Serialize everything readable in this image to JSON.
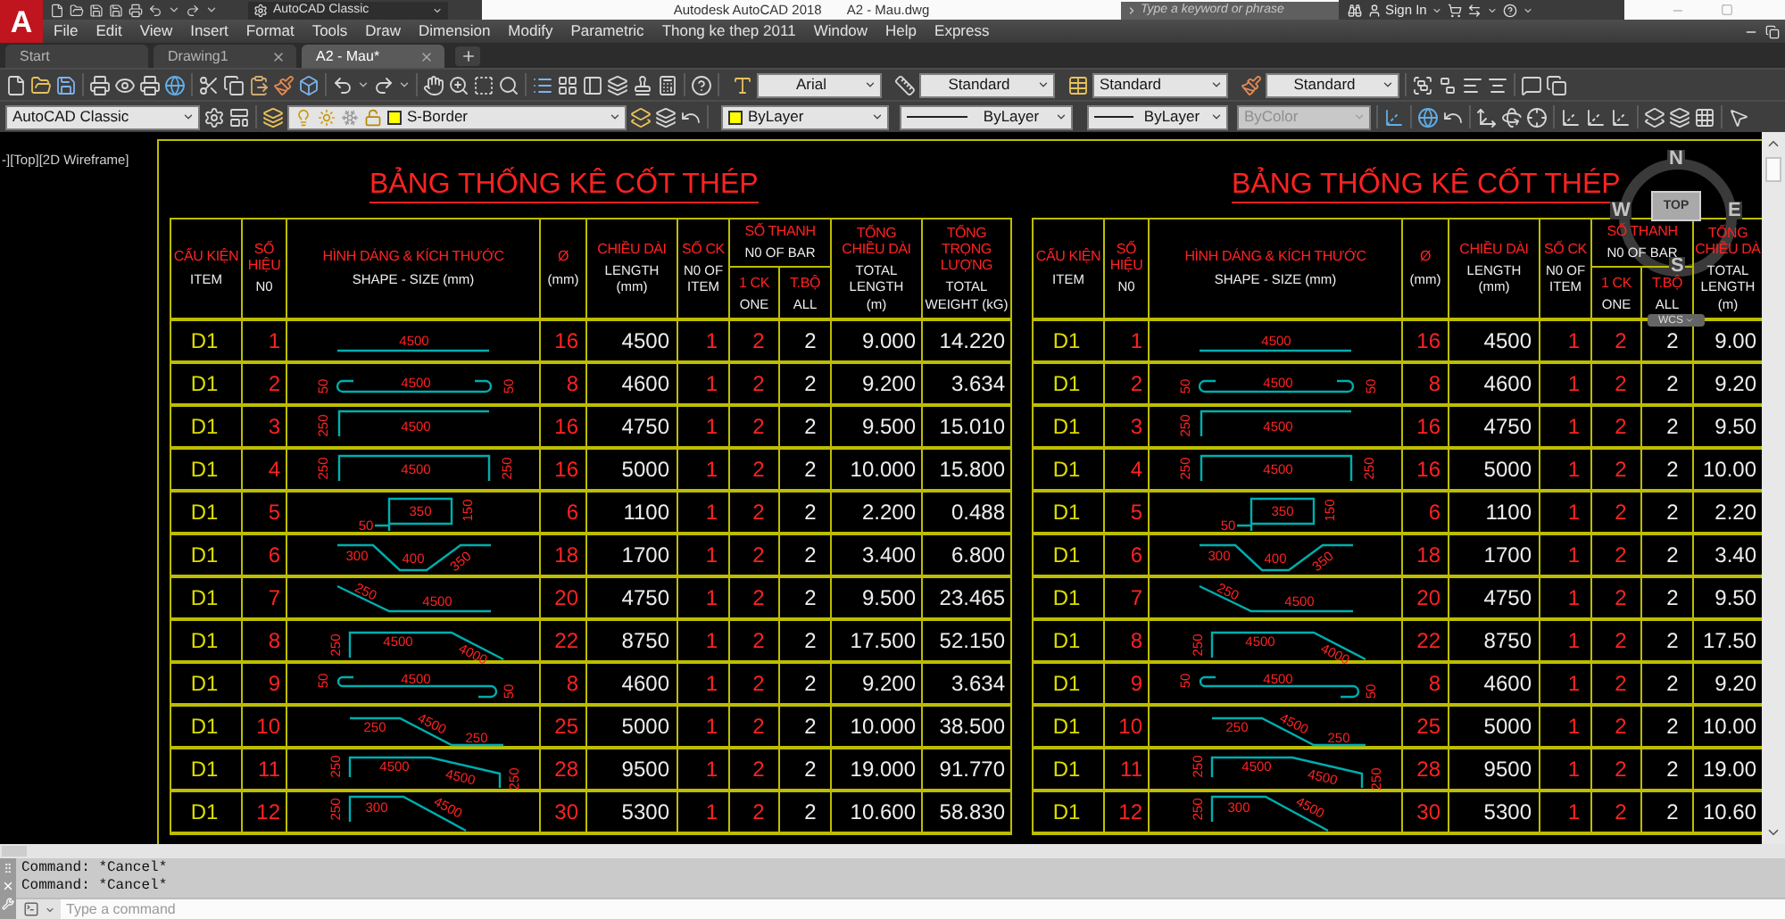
{
  "app_logo": "A",
  "title_bar": {
    "workspace": "AutoCAD Classic",
    "app": "Autodesk AutoCAD 2018",
    "file": "A2 - Mau.dwg",
    "search": {
      "placeholder": "Type a keyword or phrase"
    },
    "sign_in": "Sign In"
  },
  "menu": [
    "File",
    "Edit",
    "View",
    "Insert",
    "Format",
    "Tools",
    "Draw",
    "Dimension",
    "Modify",
    "Parametric",
    "Thong ke thep 2011",
    "Window",
    "Help",
    "Express"
  ],
  "tabs": [
    {
      "label": "Start",
      "selected": false,
      "closable": false
    },
    {
      "label": "Drawing1",
      "selected": false,
      "closable": true
    },
    {
      "label": "A2 - Mau*",
      "selected": true,
      "closable": true
    }
  ],
  "styles_toolbar": {
    "text_style": "Arial",
    "dimension_style": "Standard",
    "table_style": "Standard",
    "multileader_style": "Standard"
  },
  "properties_toolbar": {
    "workspace": "AutoCAD Classic",
    "layer": "S-Border",
    "color_control": "ByLayer",
    "linetype": "ByLayer",
    "lineweight": "ByLayer",
    "plot_style": {
      "label": "ByColor",
      "disabled": true
    }
  },
  "viewport_label": "-][Top][2D Wireframe]",
  "tables": [
    {
      "title": "BẢNG THỐNG KÊ CỐT THÉP",
      "columns": [
        {
          "vi": [
            "CẤU KIỆN"
          ],
          "en": [
            "ITEM"
          ]
        },
        {
          "vi": [
            "SỐ",
            "HIỆU"
          ],
          "en": [
            "N0"
          ]
        },
        {
          "vi": [
            "HÌNH DÁNG & KÍCH THƯỚC"
          ],
          "en": [
            "SHAPE - SIZE (mm)"
          ]
        },
        {
          "vi": [
            "Ø"
          ],
          "en": [
            "(mm)"
          ]
        },
        {
          "vi": [
            "CHIỀU DÀI"
          ],
          "en": [
            "LENGTH",
            "(mm)"
          ]
        },
        {
          "vi": [
            "SỐ CK"
          ],
          "en": [
            "N0 OF",
            "ITEM"
          ]
        },
        {
          "vi": [
            "SỐ THANH"
          ],
          "en": [
            "N0 OF BAR"
          ],
          "sub": [
            {
              "vi": [
                "1 CK"
              ],
              "en": [
                "ONE"
              ]
            },
            {
              "vi": [
                "T.BỘ"
              ],
              "en": [
                "ALL"
              ]
            }
          ]
        },
        {
          "vi": [
            "TỔNG",
            "CHIỀU DÀI"
          ],
          "en": [
            "TOTAL",
            "LENGTH",
            "(m)"
          ]
        },
        {
          "vi": [
            "TỔNG",
            "TRỌNG",
            "LƯỢNG"
          ],
          "en": [
            "TOTAL",
            "WEIGHT (kG)"
          ]
        }
      ],
      "rows": [
        {
          "item": "D1",
          "no": "1",
          "shape": {
            "kind": "straight",
            "labels": [
              "4500"
            ]
          },
          "diameter": "16",
          "length": "4500",
          "count_item": "1",
          "bars_one": "2",
          "bars_all": "2",
          "total_length": "9.000",
          "total_weight": "14.220"
        },
        {
          "item": "D1",
          "no": "2",
          "shape": {
            "kind": "double-hook",
            "labels": [
              "50",
              "4500",
              "50"
            ]
          },
          "diameter": "8",
          "length": "4600",
          "count_item": "1",
          "bars_one": "2",
          "bars_all": "2",
          "total_length": "9.200",
          "total_weight": "3.634"
        },
        {
          "item": "D1",
          "no": "3",
          "shape": {
            "kind": "l-bar",
            "labels": [
              "250",
              "4500"
            ]
          },
          "diameter": "16",
          "length": "4750",
          "count_item": "1",
          "bars_one": "2",
          "bars_all": "2",
          "total_length": "9.500",
          "total_weight": "15.010"
        },
        {
          "item": "D1",
          "no": "4",
          "shape": {
            "kind": "u-bar",
            "labels": [
              "250",
              "4500",
              "250"
            ]
          },
          "diameter": "16",
          "length": "5000",
          "count_item": "1",
          "bars_one": "2",
          "bars_all": "2",
          "total_length": "10.000",
          "total_weight": "15.800"
        },
        {
          "item": "D1",
          "no": "5",
          "shape": {
            "kind": "stirrup",
            "labels": [
              "50",
              "350",
              "150"
            ]
          },
          "diameter": "6",
          "length": "1100",
          "count_item": "1",
          "bars_one": "2",
          "bars_all": "2",
          "total_length": "2.200",
          "total_weight": "0.488"
        },
        {
          "item": "D1",
          "no": "6",
          "shape": {
            "kind": "trapezoid",
            "labels": [
              "300",
              "400",
              "350"
            ]
          },
          "diameter": "18",
          "length": "1700",
          "count_item": "1",
          "bars_one": "2",
          "bars_all": "2",
          "total_length": "3.400",
          "total_weight": "6.800"
        },
        {
          "item": "D1",
          "no": "7",
          "shape": {
            "kind": "bent-start",
            "labels": [
              "250",
              "4500"
            ]
          },
          "diameter": "20",
          "length": "4750",
          "count_item": "1",
          "bars_one": "2",
          "bars_all": "2",
          "total_length": "9.500",
          "total_weight": "23.465"
        },
        {
          "item": "D1",
          "no": "8",
          "shape": {
            "kind": "l-bent",
            "labels": [
              "250",
              "4500",
              "4000"
            ]
          },
          "diameter": "22",
          "length": "8750",
          "count_item": "1",
          "bars_one": "2",
          "bars_all": "2",
          "total_length": "17.500",
          "total_weight": "52.150"
        },
        {
          "item": "D1",
          "no": "9",
          "shape": {
            "kind": "offset-hook",
            "labels": [
              "50",
              "4500",
              "50"
            ]
          },
          "diameter": "8",
          "length": "4600",
          "count_item": "1",
          "bars_one": "2",
          "bars_all": "2",
          "total_length": "9.200",
          "total_weight": "3.634"
        },
        {
          "item": "D1",
          "no": "10",
          "shape": {
            "kind": "cranked",
            "labels": [
              "250",
              "4500",
              "250"
            ]
          },
          "diameter": "25",
          "length": "5000",
          "count_item": "1",
          "bars_one": "2",
          "bars_all": "2",
          "total_length": "10.000",
          "total_weight": "38.500"
        },
        {
          "item": "D1",
          "no": "11",
          "shape": {
            "kind": "l-slope-hook",
            "labels": [
              "250",
              "4500",
              "4500",
              "250"
            ]
          },
          "diameter": "28",
          "length": "9500",
          "count_item": "1",
          "bars_one": "2",
          "bars_all": "2",
          "total_length": "19.000",
          "total_weight": "91.770"
        },
        {
          "item": "D1",
          "no": "12",
          "shape": {
            "kind": "l-slope",
            "labels": [
              "250",
              "300",
              "4500"
            ]
          },
          "diameter": "30",
          "length": "5300",
          "count_item": "1",
          "bars_one": "2",
          "bars_all": "2",
          "total_length": "10.600",
          "total_weight": "58.830"
        }
      ]
    },
    {
      "title": "BẢNG THỐNG KÊ CỐT THÉP",
      "columns": [
        {
          "vi": [
            "CẤU KIỆN"
          ],
          "en": [
            "ITEM"
          ]
        },
        {
          "vi": [
            "SỐ",
            "HIỆU"
          ],
          "en": [
            "N0"
          ]
        },
        {
          "vi": [
            "HÌNH DÁNG & KÍCH THƯỚC"
          ],
          "en": [
            "SHAPE - SIZE (mm)"
          ]
        },
        {
          "vi": [
            "Ø"
          ],
          "en": [
            "(mm)"
          ]
        },
        {
          "vi": [
            "CHIỀU DÀI"
          ],
          "en": [
            "LENGTH",
            "(mm)"
          ]
        },
        {
          "vi": [
            "SỐ CK"
          ],
          "en": [
            "N0 OF",
            "ITEM"
          ]
        },
        {
          "vi": [
            "SỐ THANH"
          ],
          "en": [
            "N0 OF BAR"
          ],
          "sub": [
            {
              "vi": [
                "1 CK"
              ],
              "en": [
                "ONE"
              ]
            },
            {
              "vi": [
                "T.BỘ"
              ],
              "en": [
                "ALL"
              ]
            }
          ]
        },
        {
          "vi": [
            "TỔNG",
            "CHIỀU DÀ"
          ],
          "en": [
            "TOTAL",
            "LENGTH",
            "(m)"
          ]
        }
      ],
      "rows": [
        {
          "item": "D1",
          "no": "1",
          "shape": {
            "kind": "straight",
            "labels": [
              "4500"
            ]
          },
          "diameter": "16",
          "length": "4500",
          "count_item": "1",
          "bars_one": "2",
          "bars_all": "2",
          "total_length": "9.00"
        },
        {
          "item": "D1",
          "no": "2",
          "shape": {
            "kind": "double-hook",
            "labels": [
              "50",
              "4500",
              "50"
            ]
          },
          "diameter": "8",
          "length": "4600",
          "count_item": "1",
          "bars_one": "2",
          "bars_all": "2",
          "total_length": "9.20"
        },
        {
          "item": "D1",
          "no": "3",
          "shape": {
            "kind": "l-bar",
            "labels": [
              "250",
              "4500"
            ]
          },
          "diameter": "16",
          "length": "4750",
          "count_item": "1",
          "bars_one": "2",
          "bars_all": "2",
          "total_length": "9.50"
        },
        {
          "item": "D1",
          "no": "4",
          "shape": {
            "kind": "u-bar",
            "labels": [
              "250",
              "4500",
              "250"
            ]
          },
          "diameter": "16",
          "length": "5000",
          "count_item": "1",
          "bars_one": "2",
          "bars_all": "2",
          "total_length": "10.00"
        },
        {
          "item": "D1",
          "no": "5",
          "shape": {
            "kind": "stirrup",
            "labels": [
              "50",
              "350",
              "150"
            ]
          },
          "diameter": "6",
          "length": "1100",
          "count_item": "1",
          "bars_one": "2",
          "bars_all": "2",
          "total_length": "2.20"
        },
        {
          "item": "D1",
          "no": "6",
          "shape": {
            "kind": "trapezoid",
            "labels": [
              "300",
              "400",
              "350"
            ]
          },
          "diameter": "18",
          "length": "1700",
          "count_item": "1",
          "bars_one": "2",
          "bars_all": "2",
          "total_length": "3.40"
        },
        {
          "item": "D1",
          "no": "7",
          "shape": {
            "kind": "bent-start",
            "labels": [
              "250",
              "4500"
            ]
          },
          "diameter": "20",
          "length": "4750",
          "count_item": "1",
          "bars_one": "2",
          "bars_all": "2",
          "total_length": "9.50"
        },
        {
          "item": "D1",
          "no": "8",
          "shape": {
            "kind": "l-bent",
            "labels": [
              "250",
              "4500",
              "4000"
            ]
          },
          "diameter": "22",
          "length": "8750",
          "count_item": "1",
          "bars_one": "2",
          "bars_all": "2",
          "total_length": "17.50"
        },
        {
          "item": "D1",
          "no": "9",
          "shape": {
            "kind": "offset-hook",
            "labels": [
              "50",
              "4500",
              "50"
            ]
          },
          "diameter": "8",
          "length": "4600",
          "count_item": "1",
          "bars_one": "2",
          "bars_all": "2",
          "total_length": "9.20"
        },
        {
          "item": "D1",
          "no": "10",
          "shape": {
            "kind": "cranked",
            "labels": [
              "250",
              "4500",
              "250"
            ]
          },
          "diameter": "25",
          "length": "5000",
          "count_item": "1",
          "bars_one": "2",
          "bars_all": "2",
          "total_length": "10.00"
        },
        {
          "item": "D1",
          "no": "11",
          "shape": {
            "kind": "l-slope-hook",
            "labels": [
              "250",
              "4500",
              "4500",
              "250"
            ]
          },
          "diameter": "28",
          "length": "9500",
          "count_item": "1",
          "bars_one": "2",
          "bars_all": "2",
          "total_length": "19.00"
        },
        {
          "item": "D1",
          "no": "12",
          "shape": {
            "kind": "l-slope",
            "labels": [
              "250",
              "300",
              "4500"
            ]
          },
          "diameter": "30",
          "length": "5300",
          "count_item": "1",
          "bars_one": "2",
          "bars_all": "2",
          "total_length": "10.60"
        }
      ]
    }
  ],
  "viewcube": {
    "north": "N",
    "west": "W",
    "east": "E",
    "south": "S",
    "face": "TOP",
    "ucs": "WCS"
  },
  "command_history": [
    "Command: *Cancel*",
    "Command: *Cancel*"
  ],
  "command_line": {
    "placeholder": "Type a command"
  }
}
